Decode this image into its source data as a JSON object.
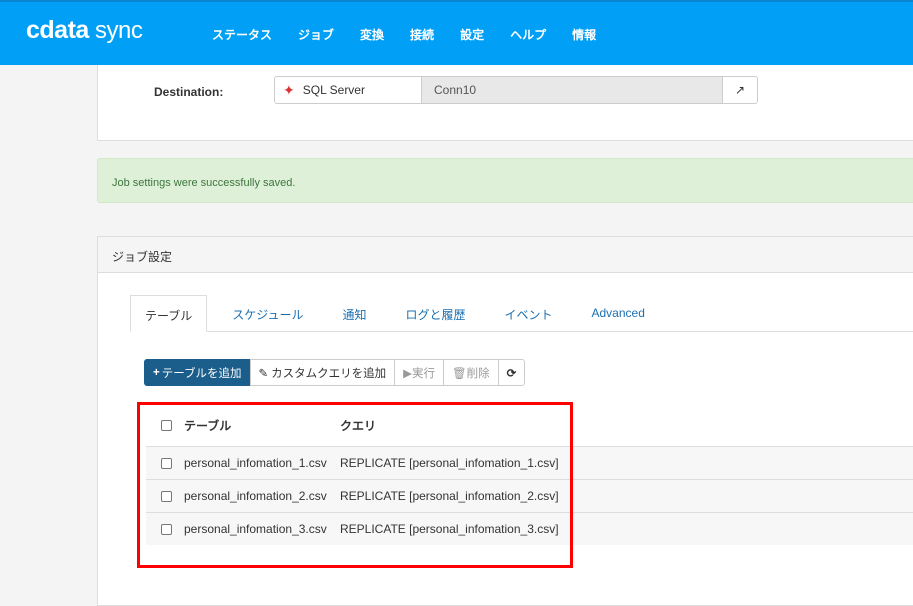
{
  "nav": {
    "logo": "cdata sync",
    "items": [
      "ステータス",
      "ジョブ",
      "変換",
      "接続",
      "設定",
      "ヘルプ",
      "情報"
    ],
    "color": "#01a0f6"
  },
  "destination": {
    "label": "Destination:",
    "source": "SQL Server",
    "connection": "Conn10",
    "icon": "external-link-icon"
  },
  "alert": {
    "message": "Job settings were successfully saved."
  },
  "panel": {
    "title": "ジョブ設定",
    "tabs": [
      "テーブル",
      "スケジュール",
      "通知",
      "ログと履歴",
      "イベント",
      "Advanced"
    ],
    "toolbar": {
      "add_table": "テーブルを追加",
      "add_query": "カスタムクエリを追加",
      "run": "実行",
      "delete": "削除"
    },
    "table": {
      "headers": [
        "テーブル",
        "クエリ"
      ],
      "rows": [
        {
          "table": "personal_infomation_1.csv",
          "query": "REPLICATE [personal_infomation_1.csv]"
        },
        {
          "table": "personal_infomation_2.csv",
          "query": "REPLICATE [personal_infomation_2.csv]"
        },
        {
          "table": "personal_infomation_3.csv",
          "query": "REPLICATE [personal_infomation_3.csv]"
        }
      ]
    }
  }
}
